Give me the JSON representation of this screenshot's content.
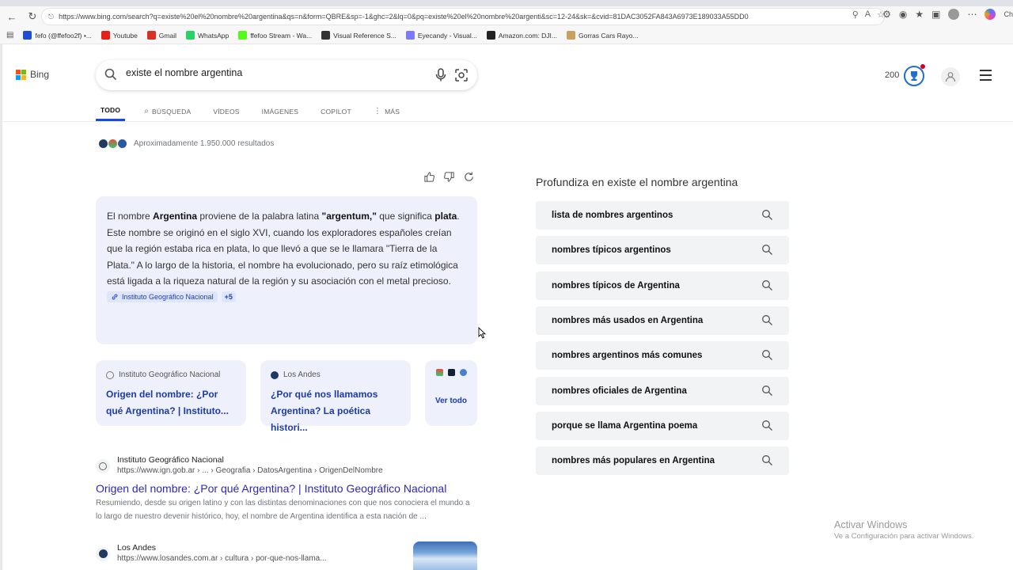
{
  "browser": {
    "url": "https://www.bing.com/search?q=existe%20el%20nombre%20argentina&qs=n&form=QBRE&sp=-1&ghc=2&lq=0&pq=existe%20el%20nombre%20argenti&sc=12-24&sk=&cvid=81DAC3052FA843A6973E189033A55DD0",
    "bookmarks": [
      {
        "label": "fefo (@ffefoo2f) •...",
        "color": "#1d4ed8"
      },
      {
        "label": "Youtube",
        "color": "#e62117"
      },
      {
        "label": "Gmail",
        "color": "#d93025"
      },
      {
        "label": "WhatsApp",
        "color": "#25d366"
      },
      {
        "label": "ffefoo Stream - Wa...",
        "color": "#53fc18"
      },
      {
        "label": "Visual Reference S...",
        "color": "#333333"
      },
      {
        "label": "Eyecandy - Visual...",
        "color": "#7a7aff"
      },
      {
        "label": "Amazon.com: DJI...",
        "color": "#222222"
      },
      {
        "label": "Gorras Cars Rayo...",
        "color": "#c8a060"
      }
    ],
    "ext_label": "Ch"
  },
  "header": {
    "logo_text": "Bing",
    "search_value": "existe el nombre argentina",
    "points": "200"
  },
  "tabs": [
    {
      "label": "TODO",
      "active": true
    },
    {
      "label": "BÚSQUEDA",
      "icon": "copilot-search-icon"
    },
    {
      "label": "VÍDEOS"
    },
    {
      "label": "IMÁGENES"
    },
    {
      "label": "COPILOT"
    },
    {
      "label": "MÁS",
      "icon": "more-dots-icon"
    }
  ],
  "results_count": "Aproximadamente 1.950.000 resultados",
  "answer": {
    "parts": [
      {
        "t": "El nombre ",
        "b": false
      },
      {
        "t": "Argentina",
        "b": true
      },
      {
        "t": " proviene de la palabra latina ",
        "b": false
      },
      {
        "t": "\"argentum,\"",
        "b": true
      },
      {
        "t": " que significa ",
        "b": false
      },
      {
        "t": "plata",
        "b": true
      },
      {
        "t": ". Este nombre se originó en el siglo XVI, cuando los exploradores españoles creían que la región estaba rica en plata, lo que llevó a que se le llamara \"Tierra de la Plata.\" A lo largo de la historia, el nombre ha evolucionado, pero su raíz etimológica está ligada a la riqueza natural de la región y su asociación con el metal precioso.",
        "b": false
      }
    ],
    "citation": "Instituto Geográfico Nacional",
    "citation_more": "+5"
  },
  "source_cards": [
    {
      "source": "Instituto Geográfico Nacional",
      "title": "Origen del nombre: ¿Por qué Argentina? | Instituto..."
    },
    {
      "source": "Los Andes",
      "title": "¿Por qué nos llamamos Argentina? La poética histori..."
    }
  ],
  "see_all": "Ver todo",
  "results": [
    {
      "site": "Instituto Geográfico Nacional",
      "url": "https://www.ign.gob.ar › ... › Geografia › DatosArgentina › OrigenDelNombre",
      "title": "Origen del nombre: ¿Por qué Argentina? | Instituto Geográfico Nacional",
      "desc": "Resumiendo, desde su origen latino y con las distintas denominaciones con que nos conociera el mundo a lo largo de nuestro devenir histórico, hoy, el nombre de Argentina identifica a esta nación de ..."
    },
    {
      "site": "Los Andes",
      "url": "https://www.losandes.com.ar › cultura › por-que-nos-llama..."
    }
  ],
  "related": {
    "title": "Profundiza en existe el nombre argentina",
    "items": [
      "lista de nombres argentinos",
      "nombres típicos argentinos",
      "nombres típicos de Argentina",
      "nombres más usados en Argentina",
      "nombres argentinos más comunes",
      "nombres oficiales de Argentina",
      "porque se llama Argentina poema",
      "nombres más populares en Argentina"
    ]
  },
  "watermark": {
    "line1": "Activar Windows",
    "line2": "Ve a Configuración para activar Windows."
  }
}
